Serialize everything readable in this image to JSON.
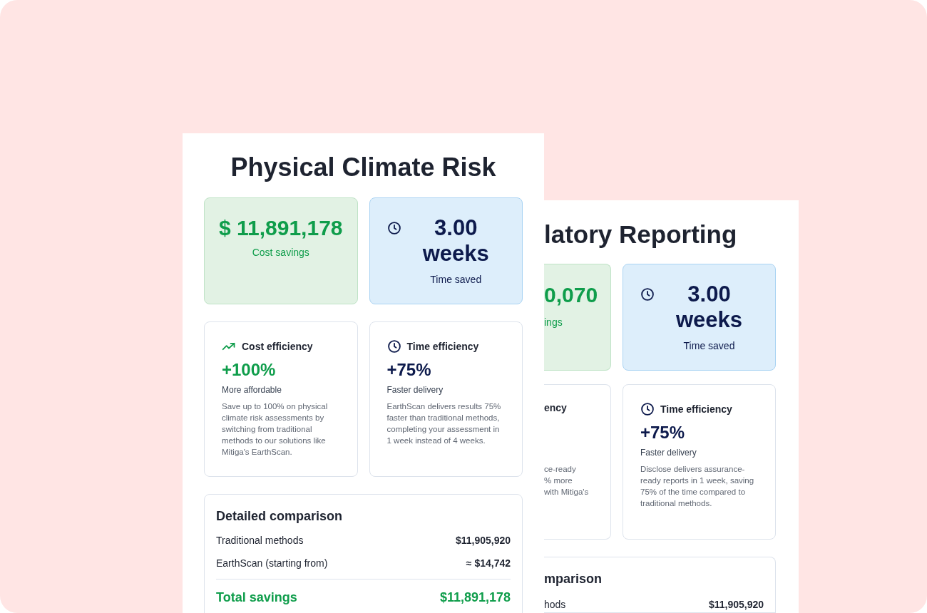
{
  "front_panel": {
    "title": "Physical Climate Risk",
    "savings": {
      "value": "$ 11,891,178",
      "label": "Cost savings"
    },
    "time": {
      "value": "3.00 weeks",
      "label": "Time saved"
    },
    "efficiency": [
      {
        "kind": "cost",
        "title": "Cost efficiency",
        "value": "+100%",
        "subtitle": "More affordable",
        "description": "Save up to 100% on physical climate risk assessments by switching from traditional methods to our solutions like Mitiga's EarthScan."
      },
      {
        "kind": "time",
        "title": "Time efficiency",
        "value": "+75%",
        "subtitle": "Faster delivery",
        "description": "EarthScan delivers results 75% faster than traditional methods, completing your assessment in 1 week instead of 4 weeks."
      }
    ],
    "comparison": {
      "title": "Detailed comparison",
      "rows": [
        {
          "label": "Traditional methods",
          "value": "$11,905,920"
        },
        {
          "label": "EarthScan (starting from)",
          "value": "≈ $14,742"
        }
      ],
      "total": {
        "label": "Total savings",
        "value": "$11,891,178"
      }
    }
  },
  "back_panel": {
    "title": "latory Reporting",
    "savings": {
      "value": "0,070",
      "label": "ings"
    },
    "time": {
      "value": "3.00 weeks",
      "label": "Time saved"
    },
    "cost_efficiency": {
      "title": "ency",
      "description_lines": [
        "ce-ready",
        "% more",
        "with Mitiga's"
      ]
    },
    "time_efficiency": {
      "kind": "time",
      "title": "Time efficiency",
      "value": "+75%",
      "subtitle": "Faster delivery",
      "description": "Disclose delivers assurance-ready reports in 1 week, saving 75% of the time compared to traditional methods."
    },
    "comparison": {
      "title": "mparison",
      "rows": [
        {
          "label": "hods",
          "value": "$11,905,920"
        }
      ]
    }
  }
}
